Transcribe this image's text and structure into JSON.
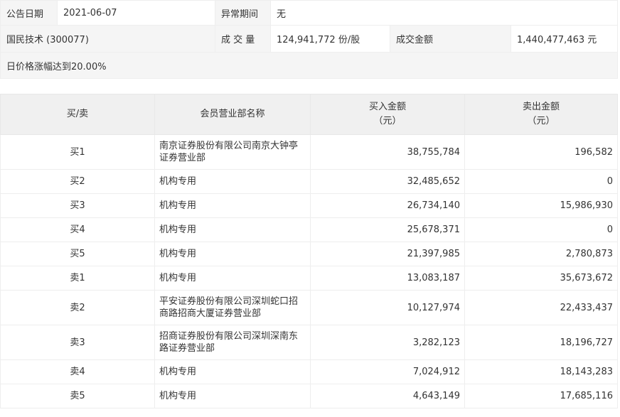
{
  "info": {
    "date_label": "公告日期",
    "date_value": "2021-06-07",
    "abnormal_label": "异常期间",
    "abnormal_value": "无",
    "stock_name": "国民技术 (300077)",
    "volume_label": "成 交 量",
    "volume_value": "124,941,772 份/股",
    "amount_label": "成交金额",
    "amount_value": "1,440,477,463 元",
    "change_text": "日价格涨幅达到20.00%"
  },
  "table": {
    "headers": {
      "side": "买/卖",
      "branch": "会员营业部名称",
      "buy_line1": "买入金额",
      "buy_line2": "（元）",
      "sell_line1": "卖出金额",
      "sell_line2": "（元）"
    },
    "rows": [
      {
        "side": "买1",
        "name": "南京证券股份有限公司南京大钟亭证券营业部",
        "buy": "38,755,784",
        "sell": "196,582"
      },
      {
        "side": "买2",
        "name": "机构专用",
        "buy": "32,485,652",
        "sell": "0"
      },
      {
        "side": "买3",
        "name": "机构专用",
        "buy": "26,734,140",
        "sell": "15,986,930"
      },
      {
        "side": "买4",
        "name": "机构专用",
        "buy": "25,678,371",
        "sell": "0"
      },
      {
        "side": "买5",
        "name": "机构专用",
        "buy": "21,397,985",
        "sell": "2,780,873"
      },
      {
        "side": "卖1",
        "name": "机构专用",
        "buy": "13,083,187",
        "sell": "35,673,672"
      },
      {
        "side": "卖2",
        "name": "平安证券股份有限公司深圳蛇口招商路招商大厦证券营业部",
        "buy": "10,127,974",
        "sell": "22,433,437"
      },
      {
        "side": "卖3",
        "name": "招商证券股份有限公司深圳深南东路证券营业部",
        "buy": "3,282,123",
        "sell": "18,196,727"
      },
      {
        "side": "卖4",
        "name": "机构专用",
        "buy": "7,024,912",
        "sell": "18,143,283"
      },
      {
        "side": "卖5",
        "name": "机构专用",
        "buy": "4,643,149",
        "sell": "17,685,116"
      }
    ]
  }
}
